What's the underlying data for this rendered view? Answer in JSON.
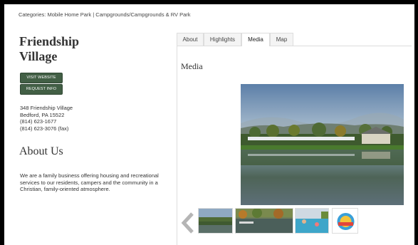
{
  "breadcrumb": {
    "prefix": "Categories:",
    "cat1": "Mobile Home Park",
    "sep": "|",
    "cat2": "Campgrounds/Campgrounds & RV Park"
  },
  "listing": {
    "title_line1": "Friendship",
    "title_line2": "Village",
    "visit_website": "VISIT WEBSITE",
    "request_info": "REQUEST INFO",
    "address_line1": "348 Friendship Village",
    "address_line2": "Bedford, PA 15522",
    "phone": "(814) 623-1677",
    "fax": "(814) 623-3076 (fax)"
  },
  "about": {
    "heading": "About Us",
    "text": "We are a family business offering housing and recreational services to our residents, campers and the community in a Christian, family-oriented atmosphere."
  },
  "tabs": [
    {
      "label": "About"
    },
    {
      "label": "Highlights"
    },
    {
      "label": "Media"
    },
    {
      "label": "Map"
    }
  ],
  "media": {
    "heading": "Media"
  },
  "icons": {
    "prev": "chevron-left-icon"
  },
  "colors": {
    "button_bg": "#425f45",
    "sky": "#6f8fb5",
    "water": "#4a5c52"
  }
}
